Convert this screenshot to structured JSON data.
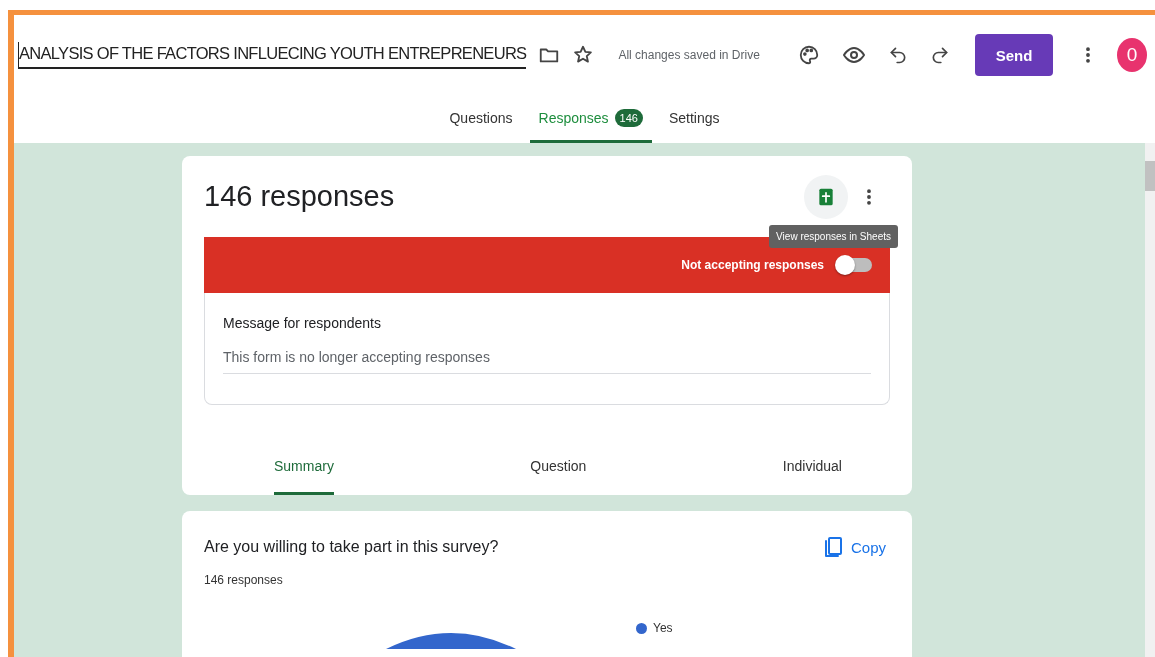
{
  "header": {
    "title": "ANALYSIS OF THE FACTORS INFLUECING YOUTH ENTREPRENEURS",
    "starred": false,
    "save_status": "All changes saved in Drive",
    "send_label": "Send",
    "avatar": "0"
  },
  "tabs": [
    {
      "label": "Questions",
      "selected": false
    },
    {
      "label": "Responses",
      "selected": true,
      "badge": "146"
    },
    {
      "label": "Settings",
      "selected": false
    }
  ],
  "summary_card": {
    "heading": "146 responses",
    "tooltip": "View responses in Sheets",
    "banner": {
      "label": "Not accepting responses",
      "on": false
    },
    "message_label": "Message for respondents",
    "message_value": "This form is no longer accepting responses",
    "view_tabs": [
      {
        "label": "Summary",
        "selected": true
      },
      {
        "label": "Question",
        "selected": false
      },
      {
        "label": "Individual",
        "selected": false
      }
    ]
  },
  "question_card": {
    "question": "Are you willing to take part in this survey?",
    "copy_label": "Copy",
    "count": "146 responses",
    "legend": [
      {
        "label": "Yes",
        "color": "#3366cc"
      }
    ]
  }
}
